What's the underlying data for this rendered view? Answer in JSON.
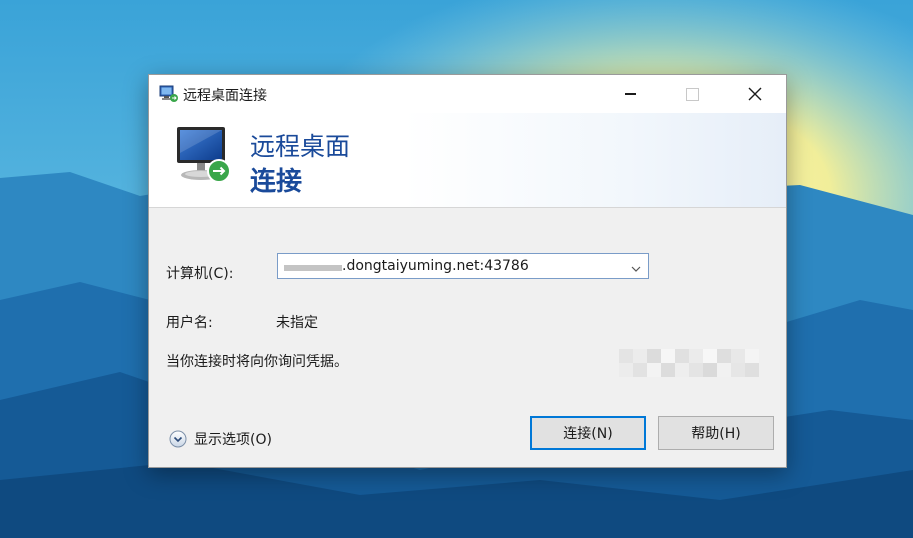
{
  "window": {
    "title": "远程桌面连接"
  },
  "banner": {
    "line1": "远程桌面",
    "line2": "连接"
  },
  "form": {
    "computer_label": "计算机(C):",
    "computer_value": ".dongtaiyuming.net:43786",
    "username_label": "用户名:",
    "username_value": "未指定",
    "credential_note": "当你连接时将向你询问凭据。"
  },
  "footer": {
    "show_options_label": "显示选项(O)"
  },
  "buttons": {
    "connect": "连接(N)",
    "help": "帮助(H)"
  },
  "colors": {
    "accent": "#0078d7",
    "banner_text": "#1a4a9a",
    "dialog_bg": "#f0f0f0"
  },
  "icons": {
    "title": "remote-desktop-icon",
    "banner": "monitor-connect-icon",
    "dropdown": "chevron-down-icon",
    "options": "expand-circle-icon"
  }
}
